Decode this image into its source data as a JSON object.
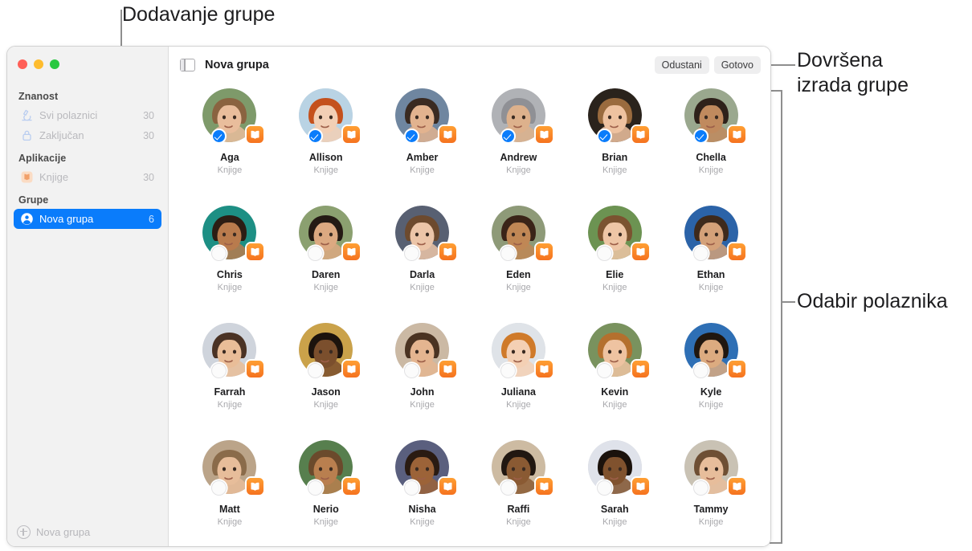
{
  "callouts": [
    {
      "id": "add-group",
      "text": "Dodavanje grupe"
    },
    {
      "id": "group-done",
      "text": "Dovršena\nizrada grupe"
    },
    {
      "id": "select-students",
      "text": "Odabir polaznika"
    }
  ],
  "window": {
    "traffic_lights": [
      "close",
      "minimize",
      "zoom"
    ],
    "toolbar": {
      "sidebar_toggle_icon": "sidebar-toggle-icon",
      "title": "Nova grupa",
      "cancel_label": "Odustani",
      "done_label": "Gotovo"
    },
    "sidebar": {
      "sections": [
        {
          "title": "Znanost",
          "items": [
            {
              "icon": "microscope-icon",
              "label": "Svi polaznici",
              "count": "30",
              "selected": false
            },
            {
              "icon": "lock-icon",
              "label": "Zaključan",
              "count": "30",
              "selected": false
            }
          ]
        },
        {
          "title": "Aplikacije",
          "items": [
            {
              "icon": "books-app-icon",
              "label": "Knjige",
              "count": "30",
              "selected": false
            }
          ]
        },
        {
          "title": "Grupe",
          "items": [
            {
              "icon": "person-circle-icon",
              "label": "Nova grupa",
              "count": "6",
              "selected": true
            }
          ]
        }
      ],
      "footer": {
        "icon": "plus-circle-icon",
        "label": "Nova grupa"
      }
    },
    "students": [
      {
        "name": "Aga",
        "app": "Knjige",
        "selected": true,
        "skin": "#e9bd9c",
        "hair": "#8a6340",
        "bg": "#7e9a6a"
      },
      {
        "name": "Allison",
        "app": "Knjige",
        "selected": true,
        "skin": "#f2cfb5",
        "hair": "#c4511d",
        "bg": "#b9d3e4"
      },
      {
        "name": "Amber",
        "app": "Knjige",
        "selected": true,
        "skin": "#e2b38f",
        "hair": "#3a2a21",
        "bg": "#6f86a0"
      },
      {
        "name": "Andrew",
        "app": "Knjige",
        "selected": true,
        "skin": "#ddb18c",
        "hair": "#8f9095",
        "bg": "#b0b2b6"
      },
      {
        "name": "Brian",
        "app": "Knjige",
        "selected": true,
        "skin": "#eec2a0",
        "hair": "#9a6b3e",
        "bg": "#2a231c"
      },
      {
        "name": "Chella",
        "app": "Knjige",
        "selected": true,
        "skin": "#c08a5e",
        "hair": "#2e211a",
        "bg": "#9aa88e"
      },
      {
        "name": "Chris",
        "app": "Knjige",
        "selected": false,
        "skin": "#b97b4d",
        "hair": "#2c1d14",
        "bg": "#1d8f84"
      },
      {
        "name": "Daren",
        "app": "Knjige",
        "selected": false,
        "skin": "#dca981",
        "hair": "#241a14",
        "bg": "#8ba070"
      },
      {
        "name": "Darla",
        "app": "Knjige",
        "selected": false,
        "skin": "#ecc5a8",
        "hair": "#6d4a2e",
        "bg": "#586072"
      },
      {
        "name": "Eden",
        "app": "Knjige",
        "selected": false,
        "skin": "#c08755",
        "hair": "#3a2418",
        "bg": "#8e9a78"
      },
      {
        "name": "Elie",
        "app": "Knjige",
        "selected": false,
        "skin": "#eec6a6",
        "hair": "#7b5330",
        "bg": "#6c9352"
      },
      {
        "name": "Ethan",
        "app": "Knjige",
        "selected": false,
        "skin": "#d4a179",
        "hair": "#3e2a1c",
        "bg": "#2b63a8"
      },
      {
        "name": "Farrah",
        "app": "Knjige",
        "selected": false,
        "skin": "#e9bd98",
        "hair": "#4a3224",
        "bg": "#cfd4dc"
      },
      {
        "name": "Jason",
        "app": "Knjige",
        "selected": false,
        "skin": "#7b4f2d",
        "hair": "#1c130d",
        "bg": "#caa24a"
      },
      {
        "name": "John",
        "app": "Knjige",
        "selected": false,
        "skin": "#e4b590",
        "hair": "#4a3322",
        "bg": "#cbb9a4"
      },
      {
        "name": "Juliana",
        "app": "Knjige",
        "selected": false,
        "skin": "#f4d0b4",
        "hair": "#cf7a2a",
        "bg": "#dfe3e8"
      },
      {
        "name": "Kevin",
        "app": "Knjige",
        "selected": false,
        "skin": "#eec3a1",
        "hair": "#b4702e",
        "bg": "#79925e"
      },
      {
        "name": "Kyle",
        "app": "Knjige",
        "selected": false,
        "skin": "#dcab80",
        "hair": "#201710",
        "bg": "#2e6fb5"
      },
      {
        "name": "Matt",
        "app": "Knjige",
        "selected": false,
        "skin": "#e7bd9a",
        "hair": "#8a6b4a",
        "bg": "#bba489"
      },
      {
        "name": "Nerio",
        "app": "Knjige",
        "selected": false,
        "skin": "#b97f4f",
        "hair": "#6b4a2c",
        "bg": "#577f4e"
      },
      {
        "name": "Nisha",
        "app": "Knjige",
        "selected": false,
        "skin": "#9c6338",
        "hair": "#2a1b12",
        "bg": "#5a5f7e"
      },
      {
        "name": "Raffi",
        "app": "Knjige",
        "selected": false,
        "skin": "#8a5a33",
        "hair": "#211711",
        "bg": "#cdbba2"
      },
      {
        "name": "Sarah",
        "app": "Knjige",
        "selected": false,
        "skin": "#80522e",
        "hair": "#1b120c",
        "bg": "#dfe2ea"
      },
      {
        "name": "Tammy",
        "app": "Knjige",
        "selected": false,
        "skin": "#e7bd9b",
        "hair": "#6e4f34",
        "bg": "#c9c2b4"
      }
    ]
  },
  "colors": {
    "accent": "#0a7cfb",
    "badge_orange": "#f5721f",
    "sidebar_bg": "#f2f2f2",
    "callout_line": "#8e8e8e"
  }
}
